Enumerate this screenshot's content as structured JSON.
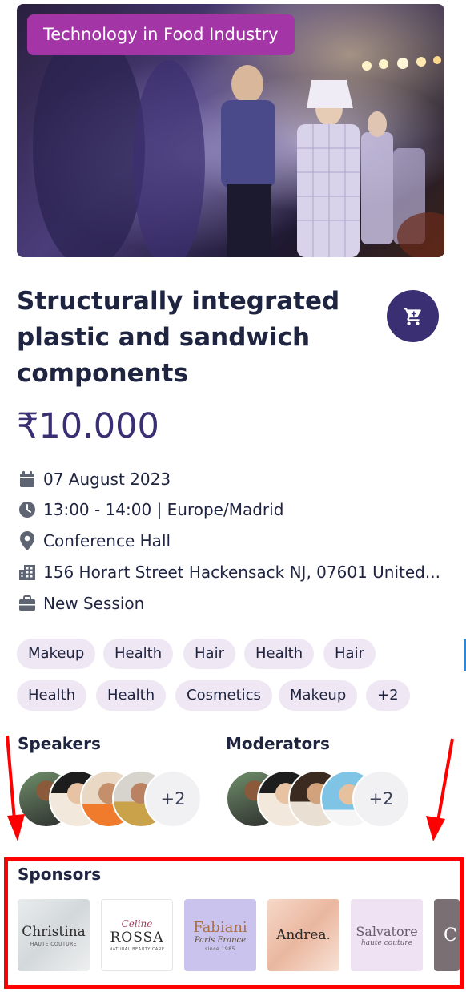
{
  "event": {
    "category": "Technology in Food Industry",
    "title": "Structurally integrated plastic and sandwich components",
    "price": "₹10.000",
    "date": "07 August 2023",
    "time": "13:00 - 14:00 | Europe/Madrid",
    "venue": "Conference Hall",
    "address": "156 Horart Street Hackensack NJ, 07601 United...",
    "session_type": "New Session"
  },
  "tags": [
    "Makeup",
    "Health",
    "Hair",
    "Health",
    "Hair",
    "Health",
    "Health",
    "Cosmetics",
    "Makeup",
    "+2"
  ],
  "speakers": {
    "title": "Speakers",
    "more": "+2"
  },
  "moderators": {
    "title": "Moderators",
    "more": "+2"
  },
  "sponsors": {
    "title": "Sponsors",
    "items": [
      {
        "name": "Christina",
        "sub": "HAUTE COUTURE"
      },
      {
        "name": "Celine ROSSA",
        "script": "Celine",
        "main": "ROSSA",
        "sub": "NATURAL BEAUTY CARE"
      },
      {
        "name": "Fabiani",
        "script": "Paris France",
        "sub": "since 1985"
      },
      {
        "name": "Andrea."
      },
      {
        "name": "Salvatore",
        "script": "haute couture"
      },
      {
        "name": "C"
      }
    ]
  },
  "icons": {
    "cart": "cart-icon",
    "calendar": "calendar-icon",
    "clock": "clock-icon",
    "location": "location-pin-icon",
    "building": "building-icon",
    "briefcase": "briefcase-icon"
  },
  "colors": {
    "brand": "#3b2f74",
    "badge": "#a335a6",
    "tag_bg": "#efe7f4",
    "highlight": "#ff0000"
  }
}
